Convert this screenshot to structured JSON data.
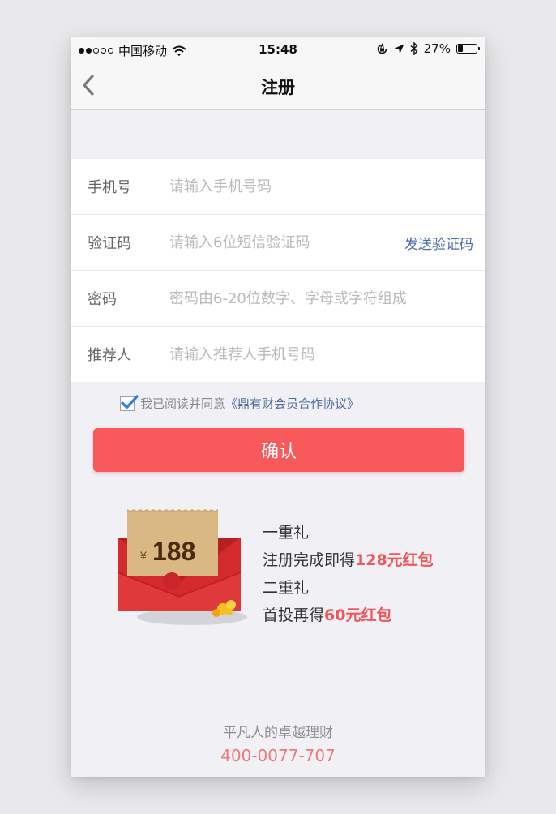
{
  "status_bar": {
    "carrier": "中国移动",
    "time": "15:48",
    "battery_percent": "27%",
    "battery_level": 0.27,
    "icons": [
      "signal-dots-icon",
      "wifi-icon",
      "rotation-lock-icon",
      "location-icon",
      "bluetooth-icon",
      "battery-icon"
    ]
  },
  "nav": {
    "title": "注册",
    "back_icon": "chevron-left-icon"
  },
  "form": {
    "phone": {
      "label": "手机号",
      "placeholder": "请输入手机号码",
      "value": ""
    },
    "code": {
      "label": "验证码",
      "placeholder": "请输入6位短信验证码",
      "value": "",
      "send_label": "发送验证码"
    },
    "password": {
      "label": "密码",
      "placeholder": "密码由6-20位数字、字母或字符组成",
      "value": ""
    },
    "referrer": {
      "label": "推荐人",
      "placeholder": "请输入推荐人手机号码",
      "value": ""
    }
  },
  "agreement": {
    "checked": true,
    "text": "我已阅读并同意",
    "link": "《鼎有财会员合作协议》"
  },
  "confirm_label": "确认",
  "gift": {
    "ticket_currency": "¥",
    "ticket_amount": "188",
    "first_title": "一重礼",
    "first_prefix": "注册完成即得",
    "first_highlight": "128元红包",
    "second_title": "二重礼",
    "second_prefix": "首投再得",
    "second_highlight": "60元红包"
  },
  "footer": {
    "slogan": "平凡人的卓越理财",
    "phone": "400-0077-707"
  },
  "colors": {
    "accent_red": "#f85a5c",
    "link_blue": "#4e6fa8",
    "highlight_red": "#f0575b",
    "page_bg": "#f1f0f5"
  }
}
